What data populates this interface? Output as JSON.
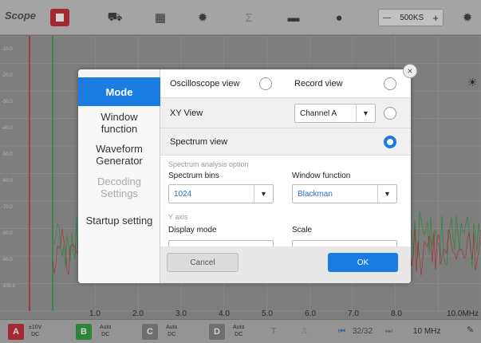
{
  "app": {
    "logo_text": "Scope",
    "sample_rate": "500KS"
  },
  "topbar": {
    "icons": [
      "record-stop-icon",
      "car-icon",
      "calendar-icon",
      "gear-icon",
      "sigma-icon",
      "folder-icon",
      "help-icon",
      "settings-icon"
    ],
    "sample_minus": "—",
    "sample_plus": "+"
  },
  "scope": {
    "x_ticks": [
      "1.0",
      "2.0",
      "3.0",
      "4.0",
      "5.0",
      "6.0",
      "7.0",
      "8.0",
      "10.0MHz"
    ],
    "y_ticks_left": [
      "-10.0",
      "-20.0",
      "-30.0",
      "-40.0",
      "-50.0",
      "-60.0",
      "-70.0",
      "-80.0",
      "-90.0",
      "-100.0"
    ]
  },
  "bottombar": {
    "channels": [
      {
        "id": "A",
        "color": "#c8323c",
        "range": "±10V",
        "coupling": "DC"
      },
      {
        "id": "B",
        "color": "#3aa24a",
        "range": "Auto",
        "coupling": "DC"
      },
      {
        "id": "C",
        "color": "#777777",
        "range": "Auto",
        "coupling": "DC"
      },
      {
        "id": "D",
        "color": "#777777",
        "range": "Auto",
        "coupling": "DC"
      }
    ],
    "page": "32/32",
    "bandwidth": "10 MHz"
  },
  "dialog": {
    "menu": [
      {
        "label": "Mode",
        "state": "active"
      },
      {
        "label": "Window function",
        "state": "normal"
      },
      {
        "label": "Waveform Generator",
        "state": "normal"
      },
      {
        "label": "Decoding Settings",
        "state": "disabled"
      },
      {
        "label": "Startup setting",
        "state": "normal"
      }
    ],
    "oscilloscope_view": "Oscilloscope view",
    "record_view": "Record view",
    "xy_view": "XY View",
    "xy_channel": "Channel A",
    "spectrum_view": "Spectrum view",
    "spectrum_option_title": "Spectrum analysis option",
    "spectrum_bins_label": "Spectrum bins",
    "spectrum_bins_value": "1024",
    "window_function_label": "Window function",
    "window_function_value": "Blackman",
    "y_axis_title": "Y axis",
    "display_mode_label": "Display mode",
    "scale_label": "Scale",
    "cancel": "Cancel",
    "ok": "OK",
    "close": "×"
  },
  "colors": {
    "accent": "#1a7be0",
    "channel_a": "#c8323c",
    "channel_b": "#3aa24a"
  }
}
